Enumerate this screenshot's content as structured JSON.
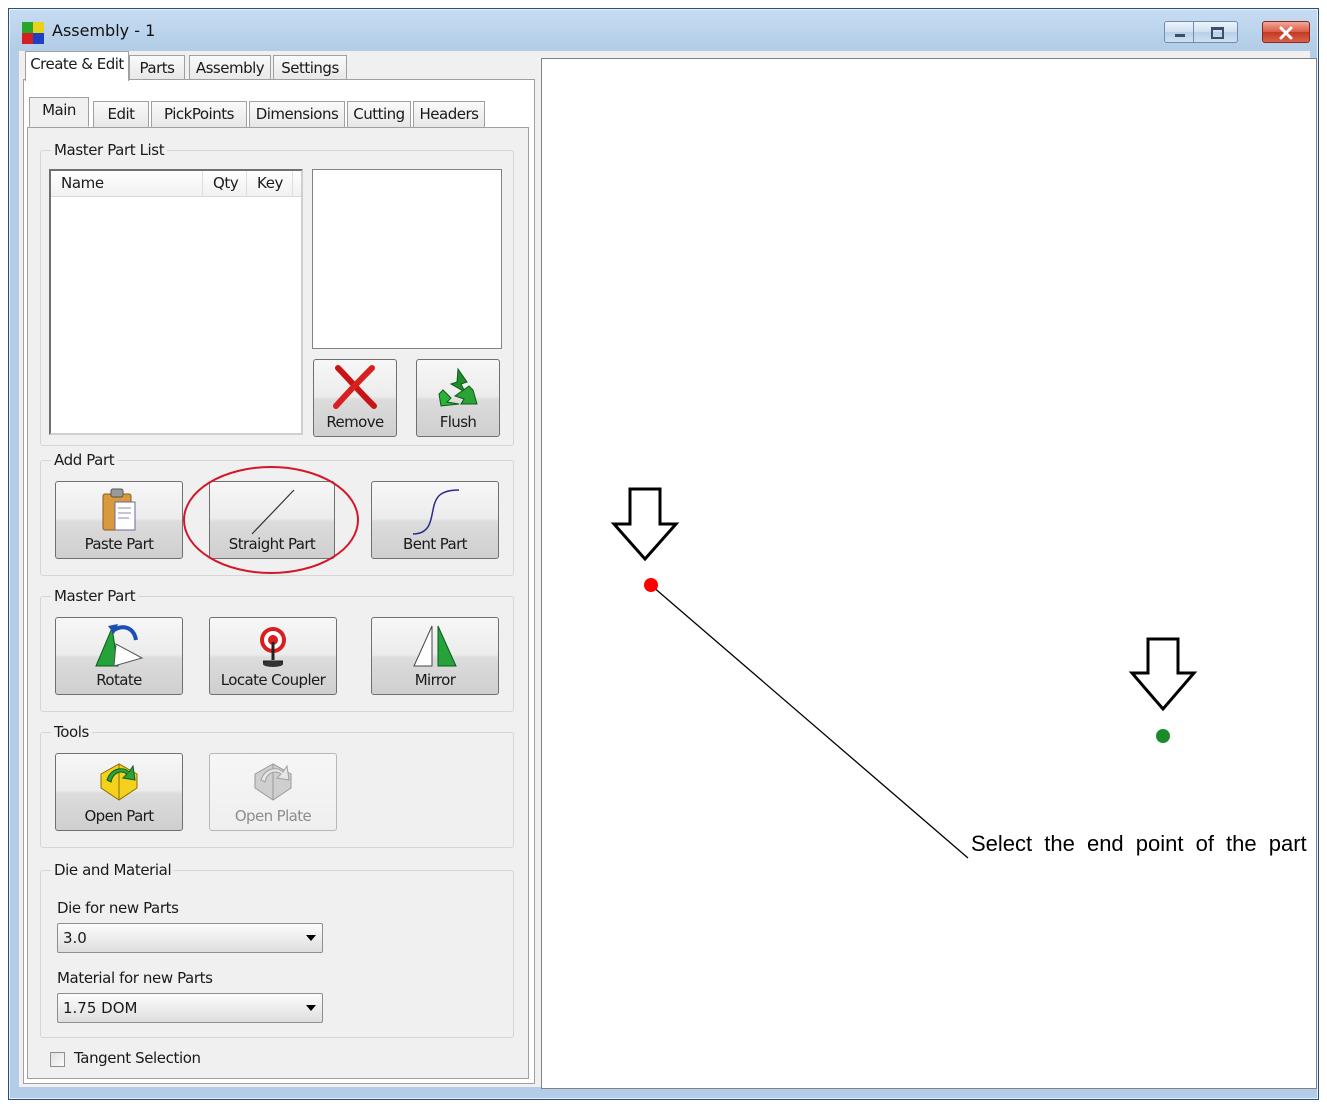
{
  "window": {
    "title": "Assembly - 1"
  },
  "main_tabs": [
    "Create & Edit",
    "Parts",
    "Assembly",
    "Settings"
  ],
  "sub_tabs": [
    "Main",
    "Edit",
    "PickPoints",
    "Dimensions",
    "Cutting",
    "Headers"
  ],
  "master_part_list": {
    "title": "Master Part List",
    "columns": [
      "Name",
      "Qty",
      "Key"
    ],
    "rows": []
  },
  "list_buttons": {
    "remove": "Remove",
    "flush": "Flush"
  },
  "add_part": {
    "title": "Add Part",
    "paste": "Paste Part",
    "straight": "Straight Part",
    "bent": "Bent Part"
  },
  "master_part": {
    "title": "Master Part",
    "rotate": "Rotate",
    "locate_coupler": "Locate Coupler",
    "mirror": "Mirror"
  },
  "tools": {
    "title": "Tools",
    "open_part": "Open Part",
    "open_plate": "Open Plate"
  },
  "die_material": {
    "title": "Die and Material",
    "die_label": "Die for new Parts",
    "die_value": "3.0",
    "material_label": "Material for new Parts",
    "material_value": "1.75 DOM"
  },
  "tangent": {
    "label": "Tangent Selection",
    "checked": false
  },
  "canvas": {
    "instruction": "Select the end point of the part",
    "start_color": "#ff0000",
    "end_color": "#1a8a2a"
  }
}
